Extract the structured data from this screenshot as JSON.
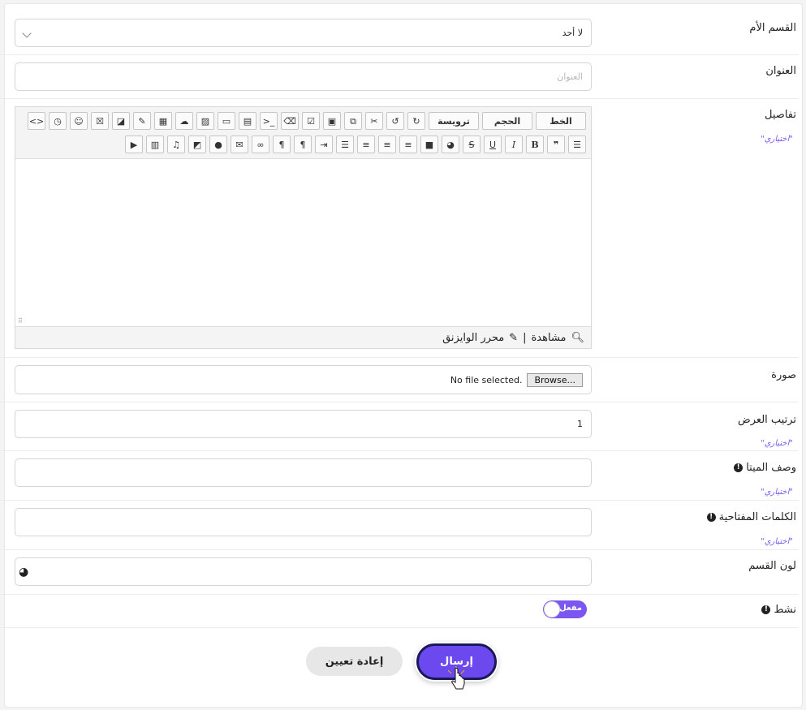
{
  "parent_category": {
    "label": "القسم الأم",
    "value": "لا أحد"
  },
  "title": {
    "label": "العنوان",
    "placeholder": "العنوان"
  },
  "details": {
    "label": "تفاصيل",
    "optional": "\"اختياري\"",
    "toolbar": {
      "font_label": "الخط",
      "size_label": "الحجم",
      "heading_label": "ترويسة"
    },
    "footer": {
      "preview_label": "مشاهدة",
      "separator": "|",
      "wysiwyg_label": "محرر الوايزنق"
    }
  },
  "image": {
    "label": "صورة",
    "browse_label": "Browse...",
    "status": "No file selected."
  },
  "display_order": {
    "label": "ترتيب العرض",
    "value": "1",
    "optional": "\"اختياري\""
  },
  "meta_description": {
    "label": "وصف الميتا",
    "optional": "\"اختياري\""
  },
  "keywords": {
    "label": "الكلمات المفتاحية",
    "optional": "\"اختياري\""
  },
  "category_color": {
    "label": "لون القسم"
  },
  "active": {
    "label": "نشط",
    "toggle_label": "مفعل",
    "state": true
  },
  "actions": {
    "submit_label": "إرسال",
    "reset_label": "إعادة تعيين"
  },
  "colors": {
    "accent": "#6c48ef",
    "optional_text": "#7a5cf5"
  }
}
